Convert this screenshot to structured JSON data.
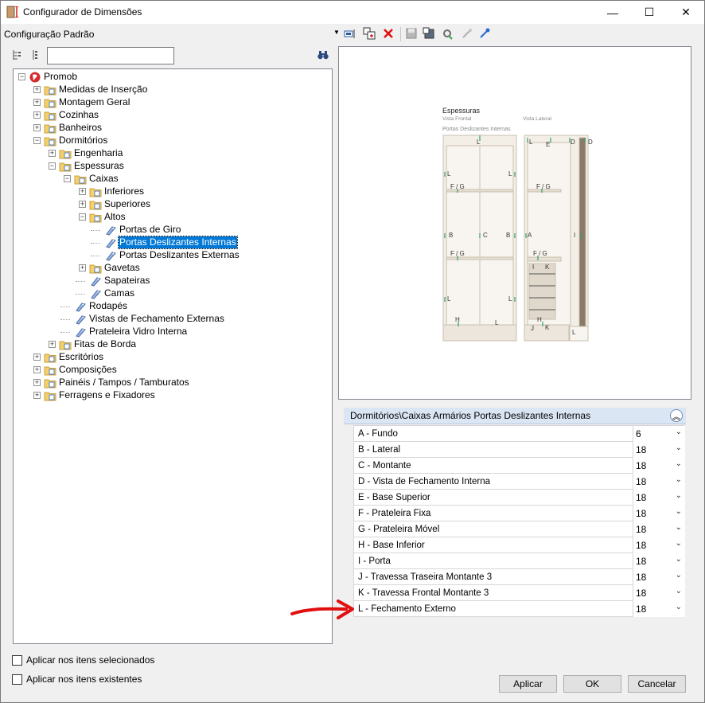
{
  "window": {
    "title": "Configurador de Dimensões",
    "controls": {
      "minimize": "—",
      "maximize": "☐",
      "close": "✕"
    }
  },
  "toolbar": {
    "config_label": "Configuração Padrão",
    "icons": [
      "dropdown-arrow-icon",
      "rename-icon",
      "copy-config-icon",
      "delete-icon",
      "save-icon",
      "export-icon",
      "settings-icon",
      "disconnect-icon",
      "connect-icon"
    ]
  },
  "tree_toolbar": {
    "search_value": "",
    "icons": [
      "tree-expand-icon",
      "tree-collapse-icon",
      "binoculars-icon"
    ]
  },
  "tree": {
    "nodes": [
      {
        "label": "Promob",
        "type": "root"
      },
      {
        "label": "Medidas de Inserção",
        "type": "folder"
      },
      {
        "label": "Montagem Geral",
        "type": "folder"
      },
      {
        "label": "Cozinhas",
        "type": "folder"
      },
      {
        "label": "Banheiros",
        "type": "folder"
      },
      {
        "label": "Dormitórios",
        "type": "folder"
      },
      {
        "label": "Engenharia",
        "type": "folder"
      },
      {
        "label": "Espessuras",
        "type": "folder"
      },
      {
        "label": "Caixas",
        "type": "folder"
      },
      {
        "label": "Inferiores",
        "type": "folder"
      },
      {
        "label": "Superiores",
        "type": "folder"
      },
      {
        "label": "Altos",
        "type": "folder"
      },
      {
        "label": "Portas de Giro",
        "type": "leaf"
      },
      {
        "label": "Portas Deslizantes Internas",
        "type": "leaf",
        "selected": true
      },
      {
        "label": "Portas Deslizantes Externas",
        "type": "leaf"
      },
      {
        "label": "Gavetas",
        "type": "folder"
      },
      {
        "label": "Sapateiras",
        "type": "leaf"
      },
      {
        "label": "Camas",
        "type": "leaf"
      },
      {
        "label": "Rodapés",
        "type": "leaf"
      },
      {
        "label": "Vistas de Fechamento Externas",
        "type": "leaf"
      },
      {
        "label": "Prateleira Vidro Interna",
        "type": "leaf"
      },
      {
        "label": "Fitas de Borda",
        "type": "folder"
      },
      {
        "label": "Escritórios",
        "type": "folder"
      },
      {
        "label": "Composições",
        "type": "folder"
      },
      {
        "label": "Painéis / Tampos / Tamburatos",
        "type": "folder"
      },
      {
        "label": "Ferragens e Fixadores",
        "type": "folder"
      }
    ]
  },
  "preview": {
    "title": "Espessuras",
    "front_view": "Vista Frontal",
    "side_view": "Vista Lateral",
    "subtitle": "Portas Deslizantes Internas",
    "labels": {
      "L": "L",
      "E": "E",
      "D": "D",
      "FG": "F / G",
      "B": "B",
      "C": "C",
      "A": "A",
      "I": "I",
      "H": "H",
      "J": "J",
      "K": "K"
    }
  },
  "properties": {
    "header": "Dormitórios\\Caixas Armários Portas Deslizantes Internas",
    "collapse_icon": "double-chevron-up-icon",
    "rows": [
      {
        "name": "A - Fundo",
        "value": "6"
      },
      {
        "name": "B - Lateral",
        "value": "18"
      },
      {
        "name": "C - Montante",
        "value": "18"
      },
      {
        "name": "D - Vista de Fechamento Interna",
        "value": "18"
      },
      {
        "name": "E - Base Superior",
        "value": "18"
      },
      {
        "name": "F - Prateleira Fixa",
        "value": "18"
      },
      {
        "name": "G - Prateleira Móvel",
        "value": "18"
      },
      {
        "name": "H - Base Inferior",
        "value": "18"
      },
      {
        "name": "I - Porta",
        "value": "18"
      },
      {
        "name": "J - Travessa Traseira Montante 3",
        "value": "18"
      },
      {
        "name": "K - Travessa Frontal Montante 3",
        "value": "18"
      },
      {
        "name": "L - Fechamento Externo",
        "value": "18"
      }
    ]
  },
  "options": {
    "apply_selected": "Aplicar nos itens selecionados",
    "apply_existing": "Aplicar nos itens existentes"
  },
  "buttons": {
    "apply": "Aplicar",
    "ok": "OK",
    "cancel": "Cancelar"
  },
  "colors": {
    "selection": "#0078d7",
    "arrow": "#e01010",
    "drawing_green": "#2e9e6a"
  }
}
